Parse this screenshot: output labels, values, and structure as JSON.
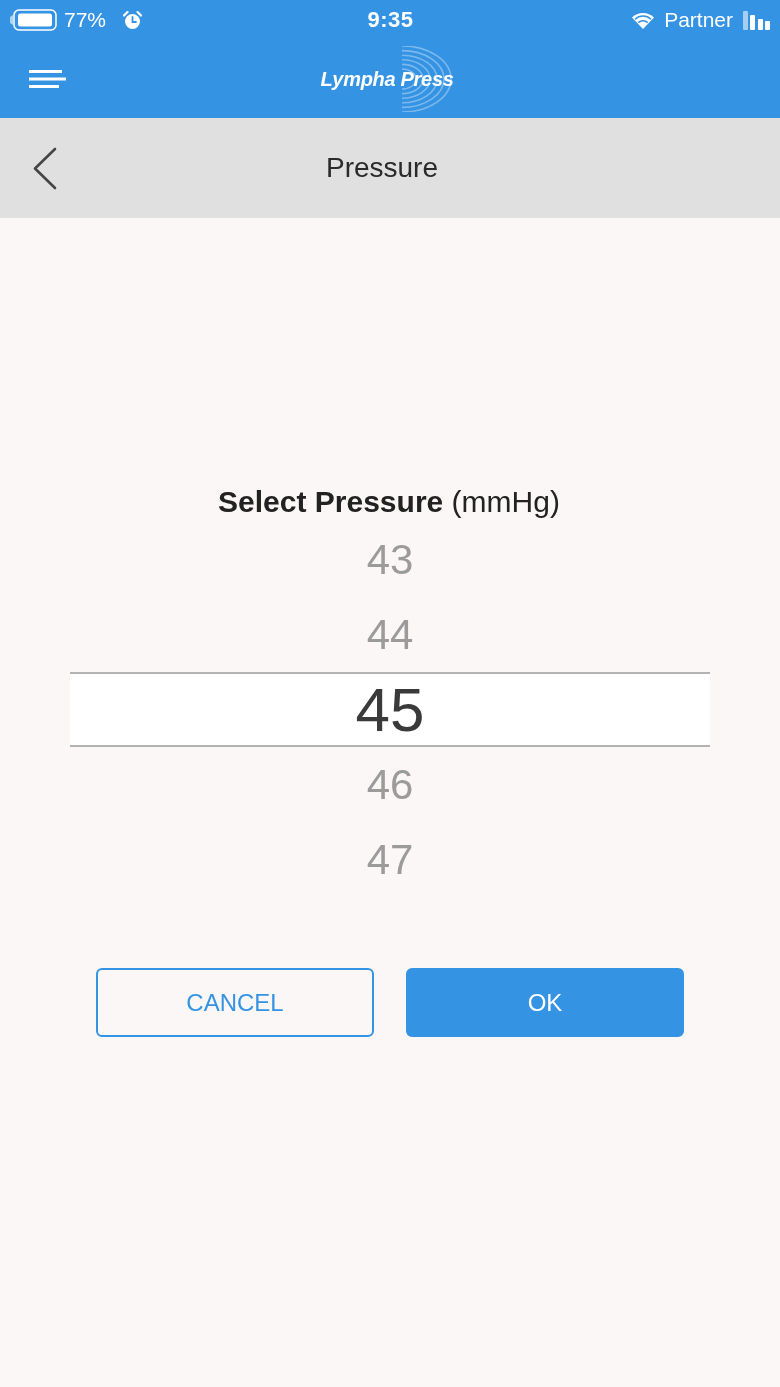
{
  "status_bar": {
    "battery": "77%",
    "time": "9:35",
    "carrier": "Partner"
  },
  "app_bar": {
    "logo": "Lympha Press"
  },
  "header": {
    "title": "Pressure"
  },
  "picker": {
    "label": "**Select Pressure** (mmHg)",
    "items": [
      {
        "value": "43",
        "selected": false
      },
      {
        "value": "44",
        "selected": false
      },
      {
        "value": "45",
        "selected": true
      },
      {
        "value": "46",
        "selected": false
      },
      {
        "value": "47",
        "selected": false
      }
    ]
  },
  "buttons": [
    {
      "label": "CANCEL",
      "kind": "outline"
    },
    {
      "label": "OK",
      "kind": "filled"
    }
  ]
}
